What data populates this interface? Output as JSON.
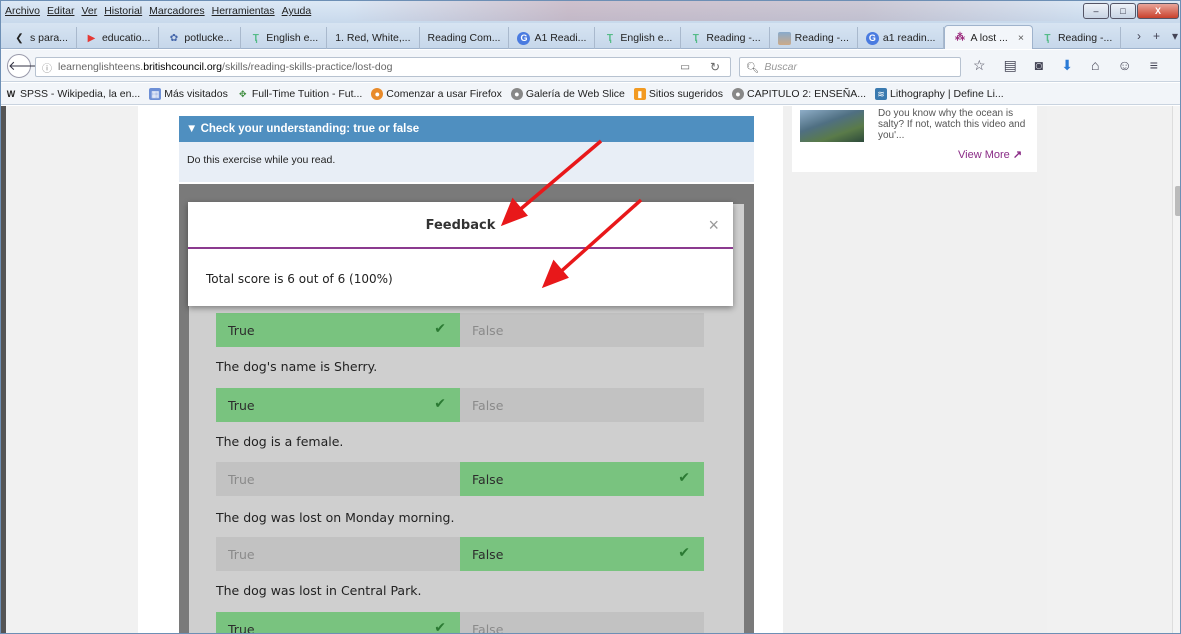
{
  "menubar": {
    "items": [
      "Archivo",
      "Editar",
      "Ver",
      "Historial",
      "Marcadores",
      "Herramientas",
      "Ayuda"
    ]
  },
  "window_controls": {
    "minimize": "–",
    "maximize": "□",
    "close": "X"
  },
  "tabs": [
    {
      "label": "s para...",
      "icon": "tab-arrow-icon"
    },
    {
      "label": "educatio...",
      "icon": "play-icon"
    },
    {
      "label": "potlucke...",
      "icon": "potluck-icon"
    },
    {
      "label": "English e...",
      "icon": "british-council-icon"
    },
    {
      "label": "1. Red, White,...",
      "icon": ""
    },
    {
      "label": "Reading Com...",
      "icon": ""
    },
    {
      "label": "A1 Readi...",
      "icon": "google-icon"
    },
    {
      "label": "English e...",
      "icon": "british-council-icon"
    },
    {
      "label": "Reading -...",
      "icon": "british-council-icon"
    },
    {
      "label": "Reading -...",
      "icon": "image-icon"
    },
    {
      "label": "a1 readin...",
      "icon": "google-icon"
    },
    {
      "label": "A lost ...",
      "icon": "learnenglish-icon",
      "active": true
    },
    {
      "label": "Reading -...",
      "icon": "british-council-icon"
    }
  ],
  "navbar": {
    "url_host": "learnenglishteens.britishcouncil.org",
    "url_prefix": "learnenglishteens.",
    "url_domain": "britishcouncil.org",
    "url_path": "/skills/reading-skills-practice/lost-dog",
    "search_placeholder": "Buscar"
  },
  "bookmarks": [
    {
      "label": "SPSS - Wikipedia, la en...",
      "icon": "wikipedia-icon"
    },
    {
      "label": "Más visitados",
      "icon": "most-visited-icon"
    },
    {
      "label": "Full-Time Tuition - Fut...",
      "icon": "tuition-icon"
    },
    {
      "label": "Comenzar a usar Firefox",
      "icon": "firefox-icon"
    },
    {
      "label": "Galería de Web Slice",
      "icon": "web-slice-icon"
    },
    {
      "label": "Sitios sugeridos",
      "icon": "suggested-sites-icon"
    },
    {
      "label": "CAPITULO 2: ENSEÑA...",
      "icon": "globe-icon"
    },
    {
      "label": "Lithography | Define Li...",
      "icon": "lithography-icon"
    }
  ],
  "exercise": {
    "header": "▼ Check your understanding: true or false",
    "instruction": "Do this exercise while you read."
  },
  "modal": {
    "title": "Feedback",
    "close": "×",
    "score_text": "Total score is 6 out of 6 (100%)"
  },
  "questions": [
    {
      "text": "",
      "true_label": "True",
      "false_label": "False",
      "selected": "true"
    },
    {
      "text": "The dog's name is Sherry.",
      "true_label": "True",
      "false_label": "False",
      "selected": "true"
    },
    {
      "text": "The dog is a female.",
      "true_label": "True",
      "false_label": "False",
      "selected": "false"
    },
    {
      "text": "The dog was lost on Monday morning.",
      "true_label": "True",
      "false_label": "False",
      "selected": "false"
    },
    {
      "text": "The dog was lost in Central Park.",
      "true_label": "True",
      "false_label": "False",
      "selected": "true"
    }
  ],
  "sidebar_card": {
    "description": "Do you know why the ocean is salty? If not, watch this video and you'...",
    "more_label": "View More"
  },
  "colors": {
    "correct_answer": "#79c37f",
    "annotation_arrow": "#e8181a",
    "accent_purple": "#8b3a8f",
    "header_blue": "#4f8fc0"
  }
}
